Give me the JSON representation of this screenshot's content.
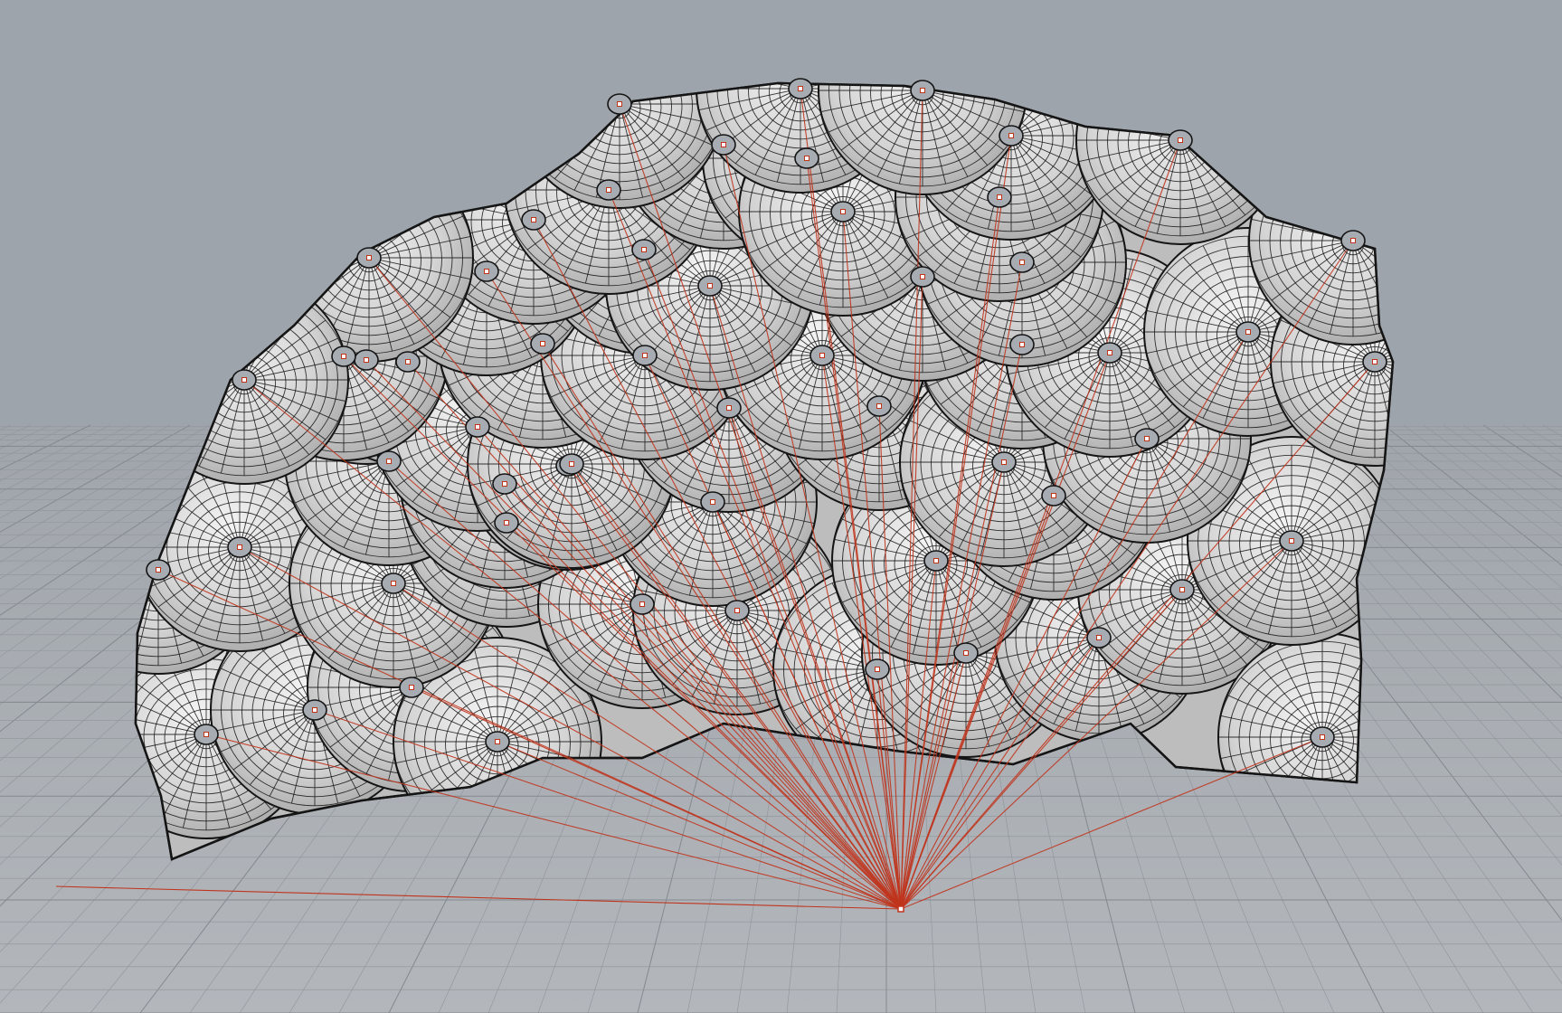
{
  "viewport": {
    "background_color": "#9ea4ab",
    "ground_color": "#a4a9af",
    "grid_line_color": "#8f949a",
    "grid_major_color": "#84898f"
  },
  "model": {
    "surface_fill": "#d5d5d5",
    "surface_highlight": "#eeeeee",
    "surface_shadow": "#9a9a9a",
    "edge_color": "#151515",
    "projection_line_color": "#c0341c",
    "cap_fill": "#a7acb3",
    "icon_names": [
      "panelized-dome-surface-icon",
      "vertex-point-icon",
      "projection-line-icon"
    ]
  }
}
